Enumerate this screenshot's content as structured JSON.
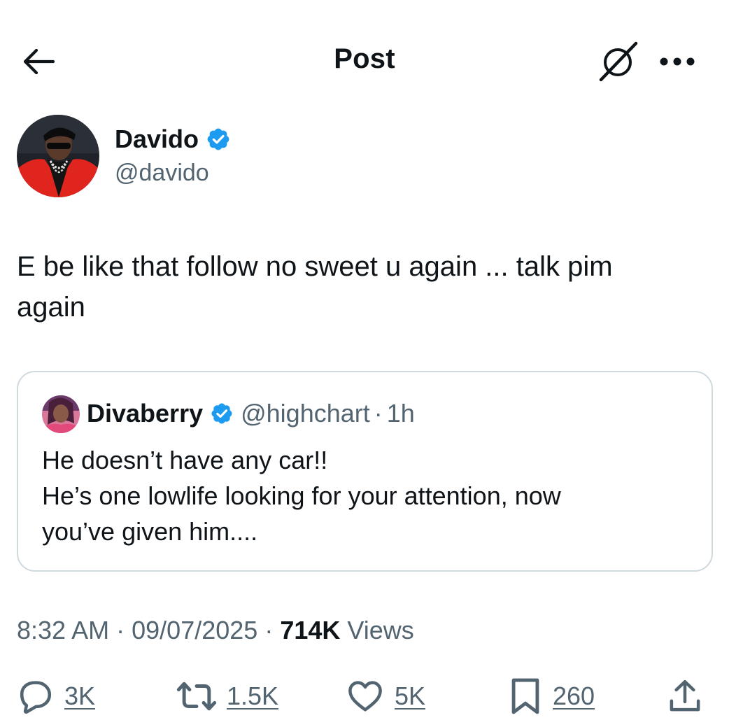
{
  "header": {
    "title": "Post",
    "back_icon": "arrow-left-icon",
    "grok_icon": "grok-icon",
    "more_icon": "more-horizontal-icon"
  },
  "author": {
    "name": "Davido",
    "handle": "@davido",
    "verified": true,
    "badge_color": "#1d9bf0"
  },
  "post": {
    "text": "E be like that follow no sweet u again ... talk pim\nagain"
  },
  "quote": {
    "name": "Divaberry",
    "handle": "@highchart",
    "separator": "·",
    "time": "1h",
    "verified": true,
    "text": "He doesn’t have any car!!\nHe’s one lowlife looking for your attention, now\nyou’ve given him...."
  },
  "meta": {
    "time": "8:32 AM",
    "date": "09/07/2025",
    "separator": "·",
    "views_count": "714K",
    "views_label": "Views"
  },
  "actions": {
    "replies": "3K",
    "reposts": "1.5K",
    "likes": "5K",
    "bookmarks": "260",
    "icons": [
      "reply-icon",
      "repost-icon",
      "like-icon",
      "bookmark-icon",
      "share-icon"
    ]
  },
  "colors": {
    "text_primary": "#0f1419",
    "text_secondary": "#536471",
    "border": "#cfd9de",
    "verified": "#1d9bf0"
  }
}
